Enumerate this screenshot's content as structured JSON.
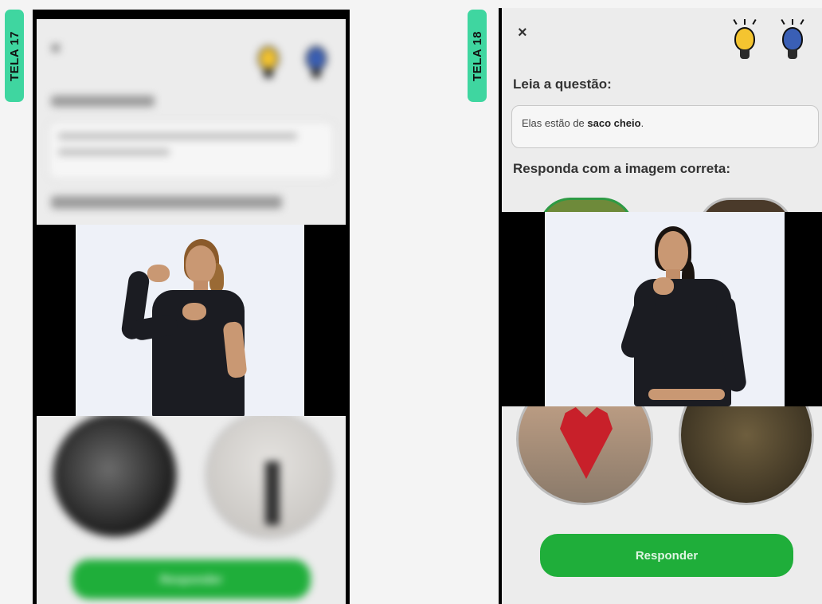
{
  "tags": {
    "left": "TELA 17",
    "right": "TELA 18"
  },
  "screen18": {
    "close_icon": "×",
    "question_title": "Leia a questão:",
    "question_prefix": "Elas estão de ",
    "question_bold": "saco cheio",
    "question_suffix": ".",
    "answer_title": "Responda com a imagem correta:",
    "button_label": "Responder"
  },
  "screen17": {
    "close_icon": "×",
    "button_label": "Responder"
  },
  "colors": {
    "tag": "#3fd6a0",
    "button": "#1fae3a",
    "bulb_yellow": "#f4c430",
    "bulb_blue": "#3a5fb5"
  },
  "icons": [
    "close-icon",
    "lightbulb-icon",
    "lightbulb-hint-icon"
  ]
}
